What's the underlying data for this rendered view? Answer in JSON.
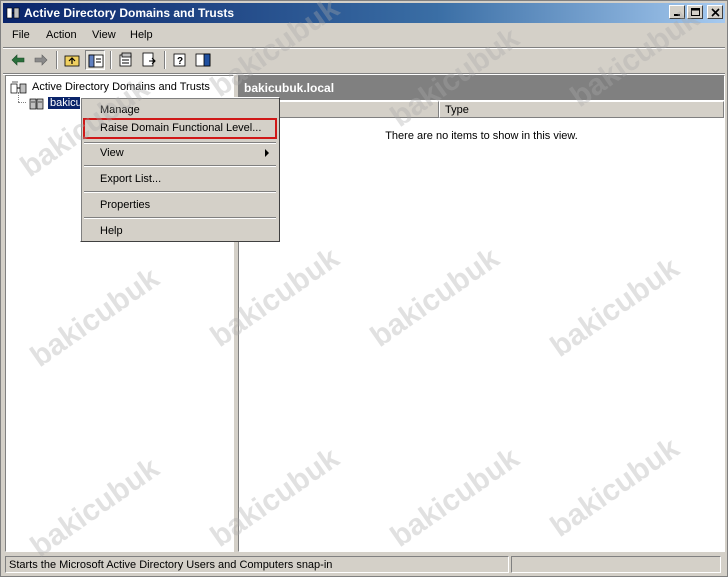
{
  "window": {
    "title": "Active Directory Domains and Trusts"
  },
  "menubar": {
    "items": [
      {
        "label": "File"
      },
      {
        "label": "Action"
      },
      {
        "label": "View"
      },
      {
        "label": "Help"
      }
    ]
  },
  "tree": {
    "root_label": "Active Directory Domains and Trusts",
    "child_label": "bakicubuk.local"
  },
  "right_pane": {
    "header": "bakicubuk.local",
    "columns": [
      {
        "label": ""
      },
      {
        "label": "Type"
      }
    ],
    "empty_message": "There are no items to show in this view."
  },
  "context_menu": {
    "items": [
      {
        "label": "Manage"
      },
      {
        "label": "Raise Domain Functional Level..."
      },
      {
        "label": "View"
      },
      {
        "label": "Export List..."
      },
      {
        "label": "Properties"
      },
      {
        "label": "Help"
      }
    ]
  },
  "statusbar": {
    "text": "Starts the Microsoft Active Directory Users and Computers snap-in"
  },
  "watermark": {
    "text": "bakicubuk"
  },
  "colors": {
    "titlebar_start": "#0a246a",
    "selection": "#0a246a",
    "highlight_box": "#d01818"
  }
}
